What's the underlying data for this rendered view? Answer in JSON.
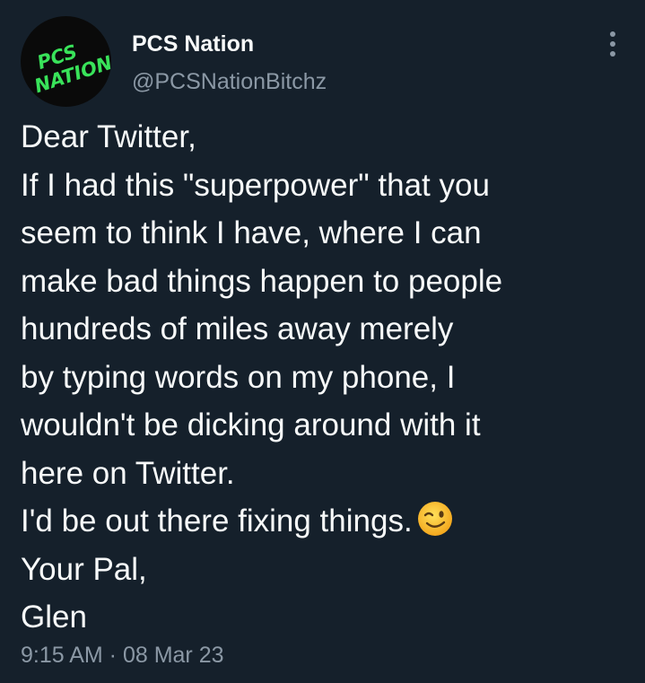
{
  "user": {
    "display_name": "PCS Nation",
    "handle": "@PCSNationBitchz",
    "avatar_text_top": "PCS",
    "avatar_text_bottom": "NATION",
    "avatar_accent_color": "#39e35a"
  },
  "menu": {
    "icon": "more-vertical-icon"
  },
  "tweet": {
    "lines": [
      "Dear Twitter,",
      "If I had this \"superpower\" that you",
      "seem to think I have, where I can",
      "make bad things happen to people",
      "hundreds of miles away merely",
      "by typing words on my phone, I",
      "wouldn't be dicking around with it",
      "here on Twitter.",
      "I'd be out there fixing things.",
      "Your Pal,",
      "Glen"
    ],
    "emoji": "winking-face-emoji"
  },
  "meta": {
    "timestamp": "9:15 AM · 08 Mar 23"
  },
  "colors": {
    "background": "#15202b",
    "primary_text": "#f7f9f9",
    "secondary_text": "#8b98a5"
  }
}
